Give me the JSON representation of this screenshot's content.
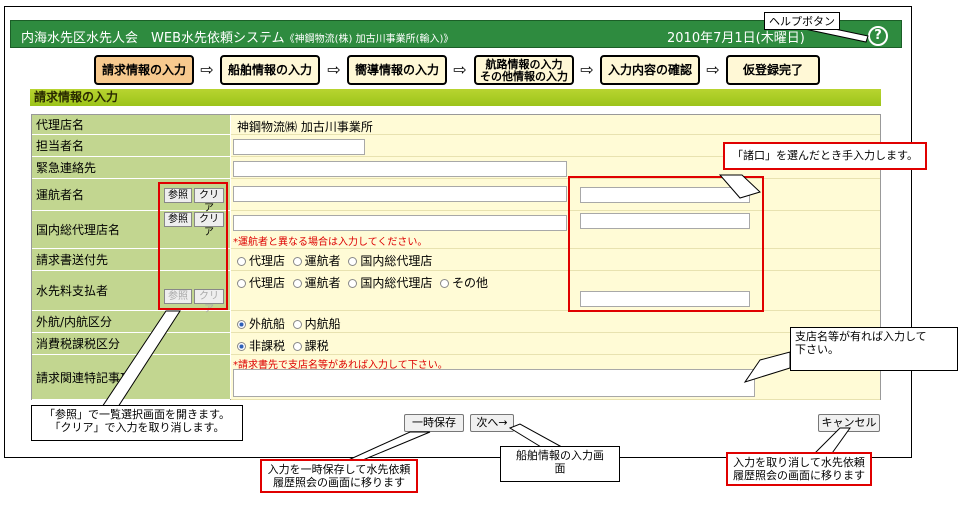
{
  "header": {
    "title": "内海水先区水先人会　WEB水先依頼システム",
    "company": "《神鋼物流(株) 加古川事業所(輸入)》",
    "date": "2010年7月1日(木曜日)"
  },
  "help": {
    "label": "ヘルプボタン",
    "icon": "question-mark-icon"
  },
  "steps": [
    {
      "label": "請求情報の入力"
    },
    {
      "label": "船舶情報の入力"
    },
    {
      "label": "嚮導情報の入力"
    },
    {
      "label1": "航路情報の入力",
      "label2": "その他情報の入力"
    },
    {
      "label": "入力内容の確認"
    },
    {
      "label": "仮登録完了"
    }
  ],
  "section_title": "請求情報の入力",
  "form": {
    "agent": {
      "label": "代理店名",
      "value": "神鋼物流㈱ 加古川事業所"
    },
    "person": {
      "label": "担当者名"
    },
    "contact": {
      "label": "緊急連絡先"
    },
    "operator": {
      "label": "運航者名"
    },
    "domestic_agent": {
      "label": "国内総代理店名",
      "note": "*運航者と異なる場合は入力してください。"
    },
    "invoice_to": {
      "label": "請求書送付先",
      "options": [
        "代理店",
        "運航者",
        "国内総代理店"
      ]
    },
    "payer": {
      "label": "水先料支払者",
      "options": [
        "代理店",
        "運航者",
        "国内総代理店",
        "その他"
      ]
    },
    "route_type": {
      "label": "外航/内航区分",
      "options": [
        "外航船",
        "内航船"
      ],
      "selected": "外航船"
    },
    "tax": {
      "label": "消費税課税区分",
      "options": [
        "非課税",
        "課税"
      ],
      "selected": "非課税"
    },
    "remarks": {
      "label": "請求関連特記事項",
      "note": "*請求書先で支店名等があれば入力して下さい。"
    },
    "ref_label": "参照",
    "clear_label": "クリア"
  },
  "buttons": {
    "save": "一時保存",
    "next": "次へ→",
    "cancel": "キャンセル"
  },
  "callouts": {
    "ref_clear_line1": "「参照」で一覧選択画面を開きます。",
    "ref_clear_line2": "「クリア」で入力を取り消します。",
    "manual_input": "「諸口」を選んだとき手入力します。",
    "branch_line1": "支店名等が有れば入力して",
    "branch_line2": "下さい。",
    "save_line1": "入力を一時保存して水先依頼",
    "save_line2": "履歴照会の画面に移ります",
    "next_line1": "船舶情報の入力画",
    "next_line2": "面",
    "cancel_line1": "入力を取り消して水先依頼",
    "cancel_line2": "履歴照会の画面に移ります"
  }
}
